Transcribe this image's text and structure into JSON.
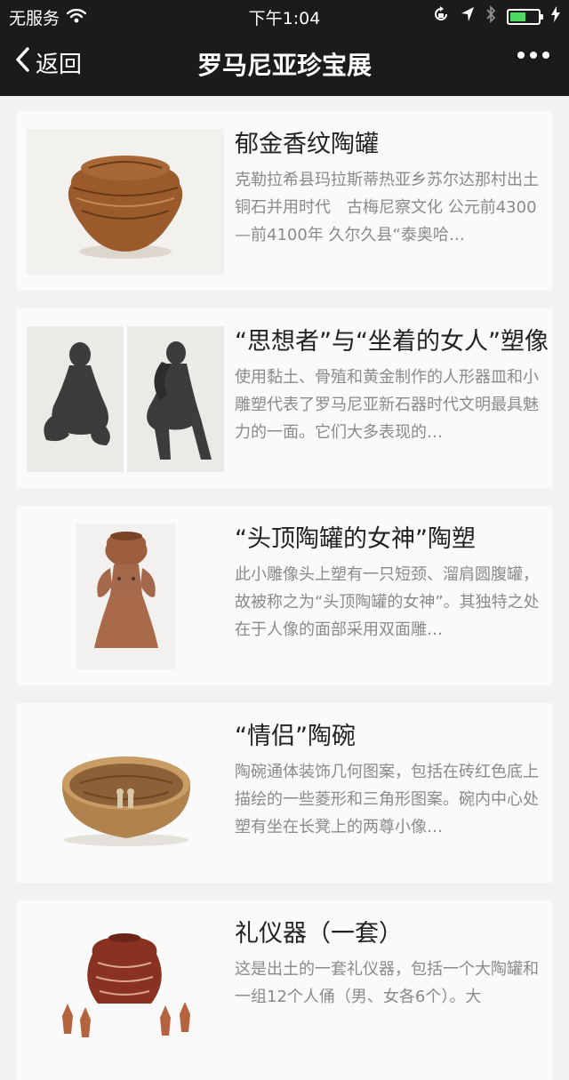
{
  "status": {
    "carrier": "无服务",
    "time": "下午1:04",
    "battery_level": 0.55,
    "accent": "#4cd964"
  },
  "nav": {
    "back_label": "返回",
    "title": "罗马尼亚珍宝展"
  },
  "items": [
    {
      "title": "郁金香纹陶罐",
      "desc": "克勒拉希县玛拉斯蒂热亚乡苏尔达那村出土 铜石并用时代　古梅尼察文化 公元前4300—前4100年 久尔久县“泰奥哈…"
    },
    {
      "title": "“思想者”与“坐着的女人”塑像",
      "desc": "使用黏土、骨殖和黄金制作的人形器皿和小雕塑代表了罗马尼亚新石器时代文明最具魅力的一面。它们大多表现的…"
    },
    {
      "title": "“头顶陶罐的女神”陶塑",
      "desc": "此小雕像头上塑有一只短颈、溜肩圆腹罐，故被称之为“头顶陶罐的女神”。其独特之处在于人像的面部采用双面雕…"
    },
    {
      "title": "“情侣”陶碗",
      "desc": "陶碗通体装饰几何图案，包括在砖红色底上描绘的一些菱形和三角形图案。碗内中心处塑有坐在长凳上的两尊小像…"
    },
    {
      "title": "礼仪器（一套）",
      "desc": "这是出土的一套礼仪器，包括一个大陶罐和一组12个人俑（男、女各6个）。大"
    }
  ]
}
